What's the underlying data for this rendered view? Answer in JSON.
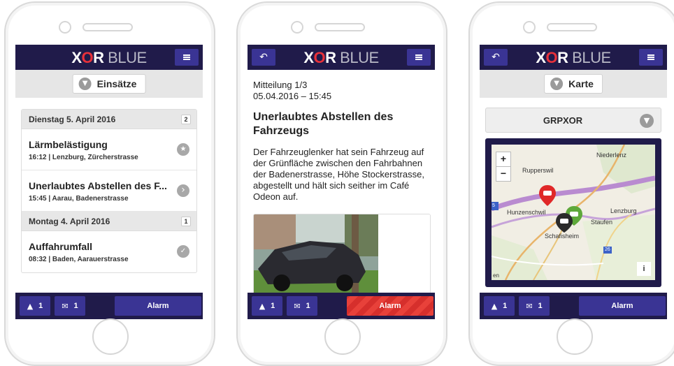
{
  "brand": {
    "xor": "X",
    "o": "O",
    "r": "R",
    "blue": "BLUE"
  },
  "colors": {
    "header": "#201b4a",
    "button": "#3a3494",
    "alarm_active": "#e8413a",
    "logo_accent": "#e8313a"
  },
  "screen1": {
    "title": "Einsätze",
    "groups": [
      {
        "date": "Dienstag 5. April 2016",
        "count": "2",
        "items": [
          {
            "name": "Lärmbelästigung",
            "sub": "16:12 | Lenzburg, Zürcherstrasse",
            "icon": "star-icon",
            "glyph": "★"
          },
          {
            "name": "Unerlaubtes Abstellen des F...",
            "sub": "15:45 | Aarau, Badenerstrasse",
            "icon": "chevron-right-icon",
            "glyph": "›"
          }
        ]
      },
      {
        "date": "Montag 4. April 2016",
        "count": "1",
        "items": [
          {
            "name": "Auffahrumfall",
            "sub": "08:32 | Baden, Aarauerstrasse",
            "icon": "check-icon",
            "glyph": "✓"
          }
        ]
      }
    ]
  },
  "screen2": {
    "meta_line1": "Mitteilung 1/3",
    "meta_line2": "05.04.2016 – 15:45",
    "heading": "Unerlaubtes Abstellen des Fahrzeugs",
    "body": "Der Fahrzeuglenker hat sein Fahrzeug auf der Grünfläche zwischen den Fahrbahnen der Badenerstrasse, Höhe Stockerstrasse, abgestellt und hält sich seither im Café Odeon auf."
  },
  "screen3": {
    "title": "Karte",
    "selected_group": "GRPXOR",
    "map": {
      "zoom_in": "+",
      "zoom_out": "−",
      "places": [
        "Niederlenz",
        "Rupperswil",
        "Hunzenschwil",
        "Lenzburg",
        "Staufen",
        "Schafisheim"
      ],
      "route_badges": [
        "5",
        "26"
      ],
      "info": "i",
      "attribution": "en"
    }
  },
  "footer": {
    "warnings": "1",
    "messages": "1",
    "alarm": "Alarm",
    "warning_glyph": "▲",
    "message_glyph": "✉"
  }
}
